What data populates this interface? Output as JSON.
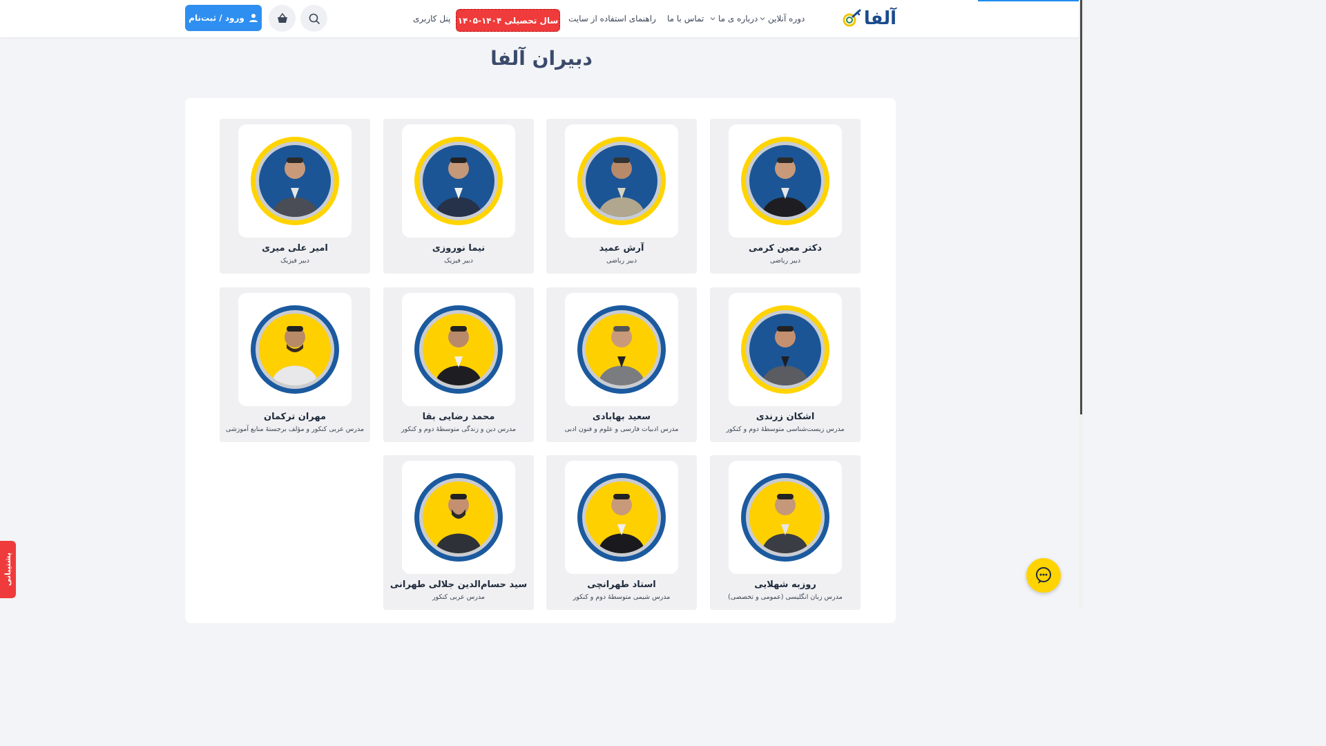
{
  "header": {
    "logo_text": "آلفا",
    "nav": {
      "online_courses": "دوره آنلاین",
      "about_us": "درباره ی ما",
      "contact_us": "تماس با ما",
      "site_guide": "راهنمای استفاده از سایت",
      "promo": "سال تحصیلی ۱۴۰۴-۱۴۰۵",
      "user_panel": "پنل کاربری"
    },
    "login_label": "ورود / ثبت‌نام",
    "accent_color": "#2f8ff0",
    "promo_color": "#ef3b3b"
  },
  "main": {
    "title": "دبیران آلفا",
    "teachers": [
      {
        "name": "دکتر معین کرمی",
        "role": "دبیر ریاضی",
        "ring": "yellow"
      },
      {
        "name": "آرش عمید",
        "role": "دبیر ریاضی",
        "ring": "yellow"
      },
      {
        "name": "نیما نوروزی",
        "role": "دبیر فیزیک",
        "ring": "yellow"
      },
      {
        "name": "امیر علی میری",
        "role": "دبیر فیزیک",
        "ring": "yellow"
      },
      {
        "name": "اشکان زرندی",
        "role": "مدرس زیست‌شناسی متوسطهٔ دوم و کنکور",
        "ring": "yellow"
      },
      {
        "name": "سعید بهابادی",
        "role": "مدرس ادبیات فارسی و علوم و فنون ادبی",
        "ring": "blue"
      },
      {
        "name": "محمد رضایی بقا",
        "role": "مدرس دین و زندگی متوسطهٔ دوم و کنکور",
        "ring": "blue"
      },
      {
        "name": "مهران ترکمان",
        "role": "مدرس عربی کنکور و مؤلف برجستهٔ منابع آموزشی",
        "ring": "blue"
      },
      {
        "name": "روزبه شهلایی",
        "role": "مدرس زبان انگلیسی (عمومی و تخصصی)",
        "ring": "blue"
      },
      {
        "name": "استاد طهرانچی",
        "role": "مدرس شیمی متوسطهٔ دوم و کنکور",
        "ring": "blue"
      },
      {
        "name": "سید حسام‌الدین جلالی طهرانی",
        "role": "مدرس عربی کنکور",
        "ring": "blue"
      }
    ]
  },
  "support_tab": "پشتیبانی",
  "icons": {
    "search": "search-icon",
    "cart": "basket-icon",
    "user": "user-icon",
    "chat": "chat-icon"
  }
}
